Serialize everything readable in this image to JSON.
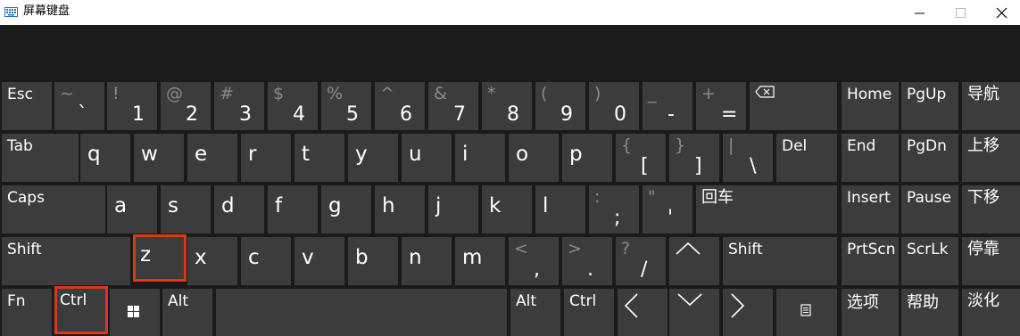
{
  "window": {
    "title": "屏幕键盘",
    "icon": "keyboard-icon"
  },
  "colors": {
    "background": "#1a1a1a",
    "key": "#3c3c3c",
    "highlight": "#d9381e",
    "secondary_text": "#8a8a8a"
  },
  "rows": {
    "r1": {
      "esc": "Esc",
      "tilde": {
        "sec": "~",
        "pri": "`"
      },
      "d1": {
        "sec": "!",
        "pri": "1"
      },
      "d2": {
        "sec": "@",
        "pri": "2"
      },
      "d3": {
        "sec": "#",
        "pri": "3"
      },
      "d4": {
        "sec": "$",
        "pri": "4"
      },
      "d5": {
        "sec": "%",
        "pri": "5"
      },
      "d6": {
        "sec": "^",
        "pri": "6"
      },
      "d7": {
        "sec": "&",
        "pri": "7"
      },
      "d8": {
        "sec": "*",
        "pri": "8"
      },
      "d9": {
        "sec": "(",
        "pri": "9"
      },
      "d0": {
        "sec": ")",
        "pri": "0"
      },
      "minus": {
        "sec": "_",
        "pri": "-"
      },
      "equal": {
        "sec": "+",
        "pri": "="
      },
      "backspace": "backspace-icon"
    },
    "r2": {
      "tab": "Tab",
      "letters": [
        "q",
        "w",
        "e",
        "r",
        "t",
        "y",
        "u",
        "i",
        "o",
        "p"
      ],
      "lbracket": {
        "sec": "{",
        "pri": "["
      },
      "rbracket": {
        "sec": "}",
        "pri": "]"
      },
      "backslash": {
        "sec": "|",
        "pri": "\\"
      },
      "del": "Del"
    },
    "r3": {
      "caps": "Caps",
      "letters": [
        "a",
        "s",
        "d",
        "f",
        "g",
        "h",
        "j",
        "k",
        "l"
      ],
      "semicolon": {
        "sec": ":",
        "pri": ";"
      },
      "quote": {
        "sec": "\"",
        "pri": "'"
      },
      "enter": "回车"
    },
    "r4": {
      "shift_left": "Shift",
      "letters": [
        "z",
        "x",
        "c",
        "v",
        "b",
        "n",
        "m"
      ],
      "comma": {
        "sec": "<",
        "pri": ","
      },
      "period": {
        "sec": ">",
        "pri": "."
      },
      "slash": {
        "sec": "?",
        "pri": "/"
      },
      "up": "up-arrow-icon",
      "shift_right": "Shift"
    },
    "r5": {
      "fn": "Fn",
      "ctrl_left": "Ctrl",
      "win": "windows-logo-icon",
      "alt_left": "Alt",
      "alt_right": "Alt",
      "ctrl_right": "Ctrl",
      "left": "left-arrow-icon",
      "down": "down-arrow-icon",
      "right": "right-arrow-icon",
      "menu": "menu-key-icon"
    }
  },
  "nav": {
    "home": "Home",
    "pgup": "PgUp",
    "nav": "导航",
    "end": "End",
    "pgdn": "PgDn",
    "moveup": "上移",
    "insert": "Insert",
    "pause": "Pause",
    "movedown": "下移",
    "prtscn": "PrtScn",
    "scrlk": "ScrLk",
    "dock": "停靠",
    "options": "选项",
    "help": "帮助",
    "fade": "淡化"
  },
  "highlighted_keys": [
    "z",
    "Ctrl"
  ]
}
